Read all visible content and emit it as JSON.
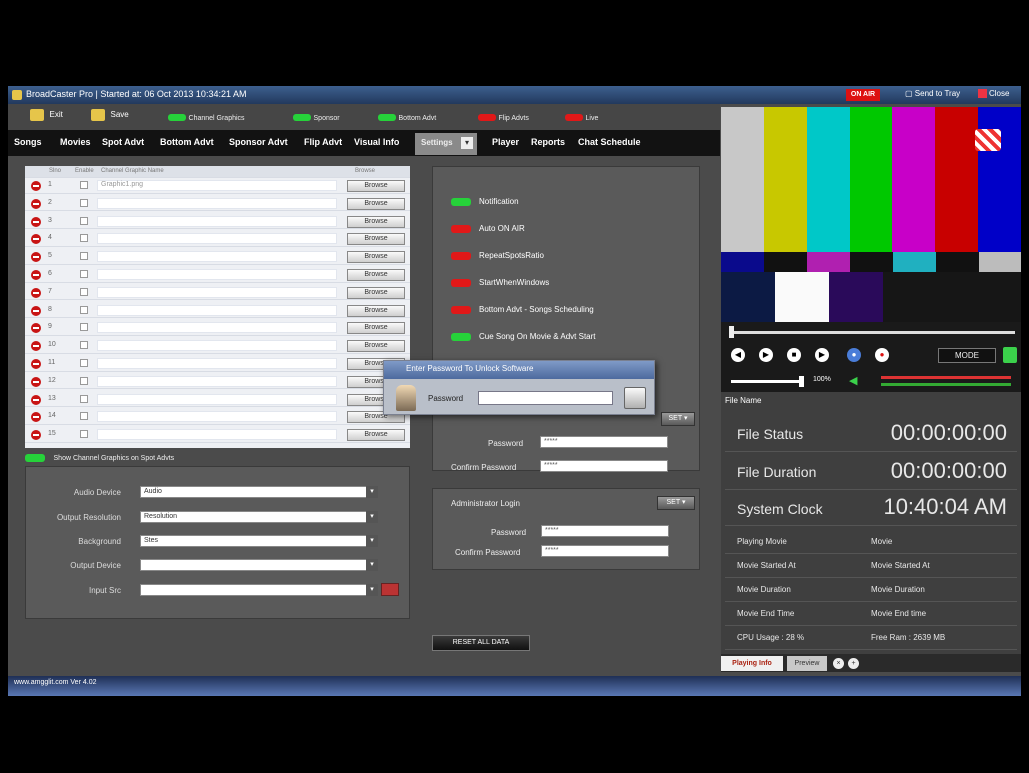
{
  "window": {
    "title": "BroadCaster Pro | Started at: 06 Oct 2013 10:34:21 AM",
    "onair_label": "ON AIR",
    "send_tray_label": "Send to Tray",
    "close_label": "Close"
  },
  "toolbar": {
    "exit_label": "Exit",
    "save_label": "Save",
    "indicators": [
      {
        "label": "Channel Graphics",
        "color": "#26d23a"
      },
      {
        "label": "Sponsor",
        "color": "#26d23a"
      },
      {
        "label": "Bottom Advt",
        "color": "#26d23a"
      },
      {
        "label": "Flip Advts",
        "color": "#e11818"
      },
      {
        "label": "Live",
        "color": "#e11818"
      }
    ]
  },
  "menu": {
    "items": [
      "Songs",
      "Movies",
      "Spot Advt",
      "Bottom Advt",
      "Sponsor Advt",
      "Flip Advt",
      "Visual Info",
      "Settings",
      "Player",
      "Reports",
      "Chat Schedule"
    ],
    "active": "Settings"
  },
  "graphics_grid": {
    "headers": [
      "",
      "Slno",
      "Enable",
      "Channel Graphic Name",
      "Browse"
    ],
    "rows": [
      {
        "no": "1",
        "name": "Graphic1.png"
      },
      {
        "no": "2",
        "name": ""
      },
      {
        "no": "3",
        "name": ""
      },
      {
        "no": "4",
        "name": ""
      },
      {
        "no": "5",
        "name": ""
      },
      {
        "no": "6",
        "name": ""
      },
      {
        "no": "7",
        "name": ""
      },
      {
        "no": "8",
        "name": ""
      },
      {
        "no": "9",
        "name": ""
      },
      {
        "no": "10",
        "name": ""
      },
      {
        "no": "11",
        "name": ""
      },
      {
        "no": "12",
        "name": ""
      },
      {
        "no": "13",
        "name": ""
      },
      {
        "no": "14",
        "name": ""
      },
      {
        "no": "15",
        "name": ""
      }
    ],
    "browse_label": "Browse",
    "footer_option": "Show Channel Graphics on Spot Advts"
  },
  "device_form": {
    "fields": [
      {
        "label": "Audio Device",
        "value": "Audio"
      },
      {
        "label": "Output Resolution",
        "value": "Resolution"
      },
      {
        "label": "Background",
        "value": "Stes"
      },
      {
        "label": "Output Device",
        "value": ""
      },
      {
        "label": "Input Src",
        "value": ""
      }
    ]
  },
  "settings_options": [
    {
      "label": "Notification",
      "color": "#26d23a"
    },
    {
      "label": "Auto ON AIR",
      "color": "#e11818"
    },
    {
      "label": "RepeatSpotsRatio",
      "color": "#e11818"
    },
    {
      "label": "StartWhenWindows",
      "color": "#e11818"
    },
    {
      "label": "Bottom Advt - Songs Scheduling",
      "color": "#e11818"
    },
    {
      "label": "Cue Song On Movie & Advt Start",
      "color": "#26d23a"
    }
  ],
  "password_section": {
    "set_label": "SET",
    "password_label": "Password",
    "password_value": "*****",
    "confirm_label": "Confirm Password",
    "confirm_value": "*****"
  },
  "admin_section": {
    "title": "Administrator Login",
    "set_label": "SET",
    "password_label": "Password",
    "password_value": "*****",
    "confirm_label": "Confirm Password",
    "confirm_value": "*****"
  },
  "reset_button": "RESET ALL DATA",
  "dialog": {
    "title": "Enter Password To Unlock Software",
    "field_label": "Password",
    "value": ""
  },
  "player": {
    "mode_label": "MODE",
    "volume_label": "100%",
    "file_name_label": "File Name",
    "color_bars": [
      "#c8c8c8",
      "#c8c800",
      "#00c8c8",
      "#00c800",
      "#c800c8",
      "#c80000",
      "#0000c8"
    ]
  },
  "playing_info": {
    "rows": [
      {
        "label": "File Status",
        "value": "00:00:00:00"
      },
      {
        "label": "File Duration",
        "value": "00:00:00:00"
      },
      {
        "label": "System Clock",
        "value": "10:40:04 AM"
      }
    ],
    "small_rows": [
      {
        "label": "Playing Movie",
        "value": "Movie"
      },
      {
        "label": "Movie Started At",
        "value": "Movie Started At"
      },
      {
        "label": "Movie Duration",
        "value": "Movie Duration"
      },
      {
        "label": "Movie End Time",
        "value": "Movie End time"
      },
      {
        "label": "CPU Usage : 28 %",
        "value": "Free Ram : 2639 MB"
      }
    ]
  },
  "bottom_tabs": [
    "Playing Info",
    "Preview"
  ],
  "status_bar": {
    "text": "www.amgglit.com  Ver 4.02"
  }
}
